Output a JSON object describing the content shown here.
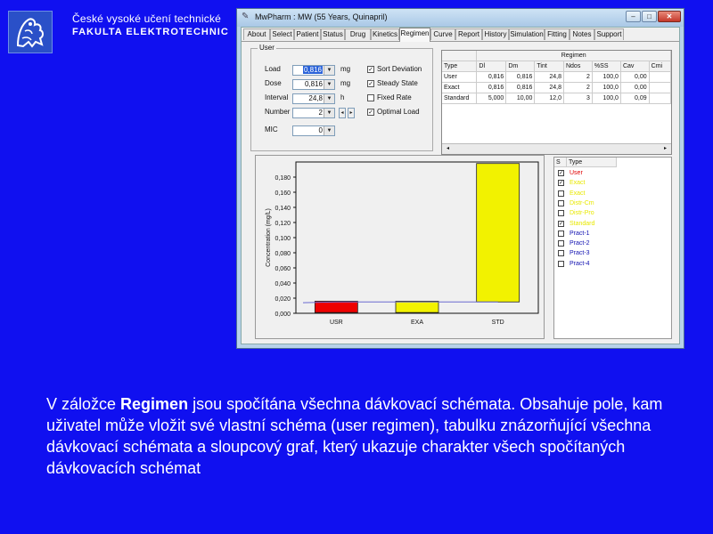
{
  "slide": {
    "institution_line1": "České vysoké učení technické",
    "institution_line2": "FAKULTA ELEKTROTECHNIC",
    "caption": {
      "pre": "V záložce ",
      "bold": "Regimen",
      "post": " jsou spočítána všechna dávkovací schémata. Obsahuje pole, kam uživatel může vložit své vlastní schéma (user regimen), tabulku znázorňující všechna dávkovací schémata a sloupcový graf, který ukazuje charakter všech spočítaných dávkovacích schémat"
    }
  },
  "window": {
    "title": "MwPharm : MW (55 Years, Quinapril)",
    "controls": {
      "minimize": "–",
      "maximize": "□",
      "close": "✕"
    },
    "tabs": [
      "About",
      "Select",
      "Patient",
      "Status",
      "Drug",
      "Kinetics",
      "Regimen",
      "Curve",
      "Report",
      "History",
      "Simulation",
      "Fitting",
      "Notes",
      "Support"
    ],
    "active_tab": "Regimen",
    "user_group": {
      "label": "User",
      "fields": [
        {
          "label": "Load",
          "value": "0,816",
          "unit": "mg"
        },
        {
          "label": "Dose",
          "value": "0,816",
          "unit": "mg"
        },
        {
          "label": "Interval",
          "value": "24,8",
          "unit": "h"
        },
        {
          "label": "Number",
          "value": "2",
          "unit": ""
        },
        {
          "label": "MIC",
          "value": "0",
          "unit": ""
        }
      ],
      "options": [
        {
          "label": "Sort Deviation",
          "checked": true
        },
        {
          "label": "Steady State",
          "checked": true
        },
        {
          "label": "Fixed Rate",
          "checked": false
        },
        {
          "label": "Optimal Load",
          "checked": true
        }
      ],
      "spin_left": "◂",
      "spin_right": "▸"
    },
    "regimen_table": {
      "group_header": "Regimen",
      "columns": [
        "Type",
        "Dl",
        "Dm",
        "Tint",
        "Ndos",
        "%SS",
        "Cav",
        "Cmi"
      ],
      "rows": [
        [
          "User",
          "0,816",
          "0,816",
          "24,8",
          "2",
          "100,0",
          "0,00",
          ""
        ],
        [
          "Exact",
          "0,816",
          "0,816",
          "24,8",
          "2",
          "100,0",
          "0,00",
          ""
        ],
        [
          "Standard",
          "5,000",
          "10,00",
          "12,0",
          "3",
          "100,0",
          "0,09",
          ""
        ]
      ],
      "scroll_left": "◂",
      "scroll_right": "▸"
    },
    "legend_list": {
      "columns": [
        "S",
        "Type"
      ],
      "items": [
        {
          "label": "User",
          "checked": true,
          "color": "#e00000"
        },
        {
          "label": "Exact",
          "checked": true,
          "color": "#e8e800"
        },
        {
          "label": "Exact",
          "checked": false,
          "color": "#e8e800"
        },
        {
          "label": "Distr-Cm",
          "checked": false,
          "color": "#e8e800"
        },
        {
          "label": "Distr-Pro",
          "checked": false,
          "color": "#e8e800"
        },
        {
          "label": "Standard",
          "checked": true,
          "color": "#e8e800"
        },
        {
          "label": "Pract-1",
          "checked": false,
          "color": "#1010b0"
        },
        {
          "label": "Pract-2",
          "checked": false,
          "color": "#1010b0"
        },
        {
          "label": "Pract-3",
          "checked": false,
          "color": "#1010b0"
        },
        {
          "label": "Pract-4",
          "checked": false,
          "color": "#1010b0"
        }
      ]
    }
  },
  "chart_data": {
    "type": "bar",
    "categories": [
      "USR",
      "EXA",
      "STD"
    ],
    "values": [
      0.016,
      0.016,
      0.198
    ],
    "colors": [
      "#ee0000",
      "#f2f200",
      "#f2f200"
    ],
    "title": "",
    "xlabel": "",
    "ylabel": "Concentration (mg/L)",
    "ylim": [
      0,
      0.2
    ],
    "yticks": [
      "0,000",
      "0,020",
      "0,040",
      "0,060",
      "0,080",
      "0,100",
      "0,120",
      "0,140",
      "0,160",
      "0,180"
    ],
    "grid": false,
    "legend": "none"
  }
}
